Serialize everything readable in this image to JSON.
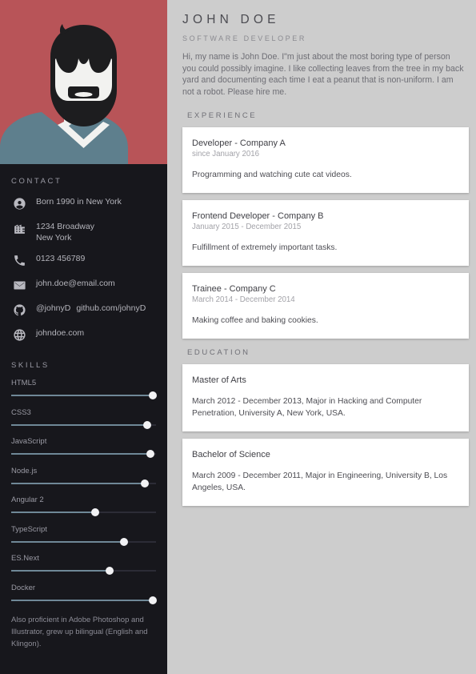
{
  "profile": {
    "name": "JOHN DOE",
    "role": "SOFTWARE DEVELOPER",
    "summary": "Hi, my name is John Doe. I\"m just about the most boring type of person you could possibly imagine. I like collecting leaves from the tree in my back yard and documenting each time I eat a peanut that is non-uniform. I am not a robot. Please hire me."
  },
  "avatar": {
    "background_color": "#b85458",
    "hair_color": "#1d1d1f",
    "skin_color": "#f2f2f0",
    "shirt_color": "#5e7f8d"
  },
  "sidebar": {
    "contact_heading": "CONTACT",
    "contacts": [
      {
        "icon": "person-circle-icon",
        "text": "Born 1990 in New York"
      },
      {
        "icon": "building-icon",
        "text": "1234 Broadway\nNew York"
      },
      {
        "icon": "phone-icon",
        "text": "0123 456789"
      },
      {
        "icon": "envelope-icon",
        "text": "john.doe@email.com"
      },
      {
        "icon": "github-icon",
        "handle": "@johnyD",
        "url": "github.com/johnyD"
      },
      {
        "icon": "globe-icon",
        "text": "johndoe.com"
      }
    ],
    "skills_heading": "SKILLS",
    "skills": [
      {
        "label": "HTML5",
        "value": 98
      },
      {
        "label": "CSS3",
        "value": 94
      },
      {
        "label": "JavaScript",
        "value": 96
      },
      {
        "label": "Node.js",
        "value": 92
      },
      {
        "label": "Angular 2",
        "value": 58
      },
      {
        "label": "TypeScript",
        "value": 78
      },
      {
        "label": "ES.Next",
        "value": 68
      },
      {
        "label": "Docker",
        "value": 98
      }
    ],
    "note": "Also proficient in Adobe Photoshop and Illustrator, grew up bilingual (English and Klingon)."
  },
  "experience": {
    "heading": "EXPERIENCE",
    "items": [
      {
        "title": "Developer - Company A",
        "date": "since January 2016",
        "body": "Programming and watching cute cat videos."
      },
      {
        "title": "Frontend Developer - Company B",
        "date": "January 2015 - December 2015",
        "body": "Fulfillment of extremely important tasks."
      },
      {
        "title": "Trainee - Company C",
        "date": "March 2014 - December 2014",
        "body": "Making coffee and baking cookies."
      }
    ]
  },
  "education": {
    "heading": "EDUCATION",
    "items": [
      {
        "title": "Master of Arts",
        "body": "March 2012 - December 2013, Major in Hacking and Computer Penetration, University A, New York, USA."
      },
      {
        "title": "Bachelor of Science",
        "body": "March 2009 - December 2011, Major in Engineering, University B, Los Angeles, USA."
      }
    ]
  },
  "colors": {
    "sidebar_bg": "#17171c",
    "main_bg": "#cdcdcd",
    "card_bg": "#ffffff",
    "accent_red": "#b85458",
    "skill_fill": "#6f8897"
  }
}
